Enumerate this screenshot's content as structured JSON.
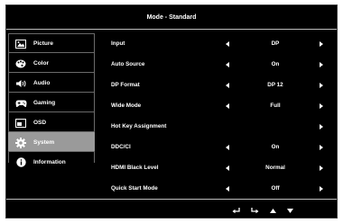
{
  "title": "Mode - Standard",
  "sidebar": {
    "items": [
      {
        "label": "Picture",
        "icon": "picture-icon"
      },
      {
        "label": "Color",
        "icon": "palette-icon"
      },
      {
        "label": "Audio",
        "icon": "speaker-icon"
      },
      {
        "label": "Gaming",
        "icon": "gamepad-icon"
      },
      {
        "label": "OSD",
        "icon": "osd-window-icon"
      },
      {
        "label": "System",
        "icon": "gear-icon",
        "selected": true
      },
      {
        "label": "Information",
        "icon": "info-icon"
      }
    ]
  },
  "settings": {
    "rows": [
      {
        "label": "Input",
        "value": "DP"
      },
      {
        "label": "Auto Source",
        "value": "On"
      },
      {
        "label": "DP Format",
        "value": "DP 12"
      },
      {
        "label": "Wide Mode",
        "value": "Full"
      },
      {
        "label": "Hot Key Assignment",
        "value": ""
      },
      {
        "label": "DDC/CI",
        "value": "On"
      },
      {
        "label": "HDMI Black Level",
        "value": "Normal"
      },
      {
        "label": "Quick Start Mode",
        "value": "Off"
      }
    ]
  },
  "nav_keys": [
    "return-icon",
    "enter-icon",
    "up-arrow-icon",
    "down-arrow-icon"
  ],
  "colors": {
    "background": "#000000",
    "text": "#ffffff",
    "selected": "#9a9a9a",
    "divider": "#bdbdbd"
  }
}
